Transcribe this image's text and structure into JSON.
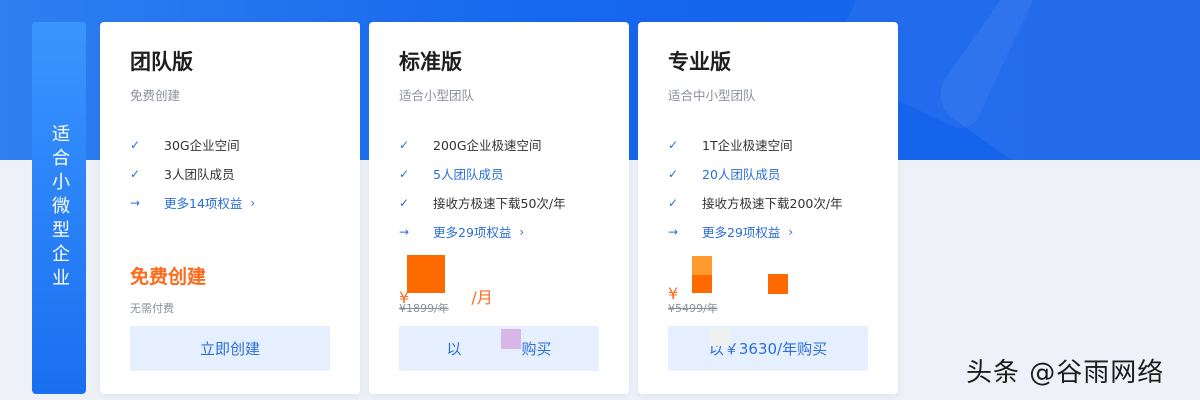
{
  "side_tab": {
    "label": "适合小微型企业"
  },
  "plans": [
    {
      "name": "团队版",
      "subtitle": "免费创建",
      "features": [
        "30G企业空间",
        "3人团队成员"
      ],
      "more_link": "更多14项权益",
      "price_text": "免费创建",
      "price_note": "无需付费",
      "button": "立即创建"
    },
    {
      "name": "标准版",
      "subtitle": "适合小型团队",
      "features": [
        "200G企业极速空间",
        "5人团队成员",
        "接收方极速下载50次/年"
      ],
      "more_link": "更多29项权益",
      "currency": "¥",
      "price_unit": "/月",
      "old_price": "¥1899/年",
      "button_left": "以",
      "button_right": "购买"
    },
    {
      "name": "专业版",
      "subtitle": "适合中小型团队",
      "features": [
        "1T企业极速空间",
        "20人团队成员",
        "接收方极速下载200次/年"
      ],
      "more_link": "更多29项权益",
      "currency": "¥",
      "old_price": "¥5499/年",
      "button_text": "以￥3630/年购买"
    }
  ],
  "watermark": "头条 @谷雨网络",
  "colors": {
    "brand_blue": "#1668ee",
    "accent_orange": "#ff6a1a",
    "link_blue": "#2b6fd8",
    "button_bg": "#e6efff"
  },
  "icons": {
    "check": "check-icon",
    "arrow": "arrow-right-icon",
    "chevron": "chevron-right-icon"
  }
}
